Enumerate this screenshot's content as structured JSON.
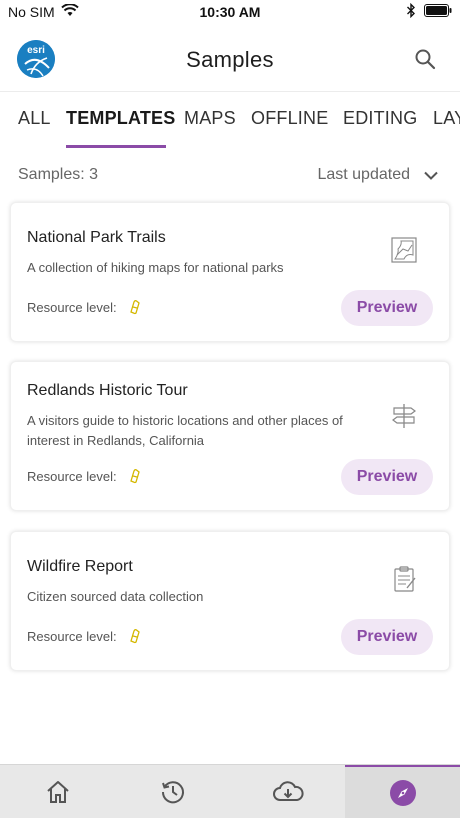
{
  "status": {
    "carrier": "No SIM",
    "time": "10:30 AM"
  },
  "header": {
    "title": "Samples",
    "logo_text": "esri"
  },
  "tabs": [
    {
      "label": "ALL",
      "active": false
    },
    {
      "label": "TEMPLATES",
      "active": true
    },
    {
      "label": "MAPS",
      "active": false
    },
    {
      "label": "OFFLINE",
      "active": false
    },
    {
      "label": "EDITING",
      "active": false
    },
    {
      "label": "LAY",
      "active": false
    }
  ],
  "list": {
    "count_label": "Samples: 3",
    "sort_label": "Last updated"
  },
  "cards": [
    {
      "title": "National Park Trails",
      "description": "A collection of hiking maps for national parks",
      "resource_label": "Resource level:",
      "preview_label": "Preview",
      "icon": "map-trail-icon"
    },
    {
      "title": "Redlands Historic Tour",
      "description": "A visitors guide to historic locations and other places of interest in Redlands, California",
      "resource_label": "Resource level:",
      "preview_label": "Preview",
      "icon": "signpost-icon"
    },
    {
      "title": "Wildfire Report",
      "description": "Citizen sourced data collection",
      "resource_label": "Resource level:",
      "preview_label": "Preview",
      "icon": "clipboard-icon"
    }
  ],
  "bottom_nav": [
    {
      "name": "home-icon",
      "active": false
    },
    {
      "name": "history-icon",
      "active": false
    },
    {
      "name": "cloud-download-icon",
      "active": false
    },
    {
      "name": "compass-icon",
      "active": true
    }
  ],
  "colors": {
    "accent": "#8b4ba7",
    "preview_bg": "#f1e7f5",
    "logo": "#1a7fc1",
    "resource_icon": "#e0c200"
  }
}
